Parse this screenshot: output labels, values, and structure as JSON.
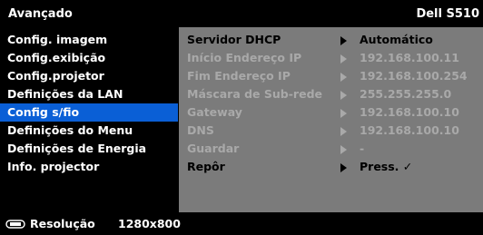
{
  "header": {
    "title": "Avançado",
    "brand": "Dell S510"
  },
  "menu": {
    "items": [
      {
        "label": "Config. imagem"
      },
      {
        "label": "Config.exibição"
      },
      {
        "label": "Config.projetor"
      },
      {
        "label": "Definições da LAN"
      },
      {
        "label": "Config s/fio",
        "selected": true
      },
      {
        "label": "Definições do Menu"
      },
      {
        "label": "Definições de Energia"
      },
      {
        "label": "Info. projector"
      }
    ]
  },
  "settings": {
    "rows": [
      {
        "label": "Servidor DHCP",
        "value": "Automático"
      },
      {
        "label": "Início Endereço IP",
        "value": "192.168.100.11"
      },
      {
        "label": "Fim Endereço IP",
        "value": "192.168.100.254"
      },
      {
        "label": "Máscara de Sub-rede",
        "value": "255.255.255.0"
      },
      {
        "label": "Gateway",
        "value": "192.168.100.10"
      },
      {
        "label": "DNS",
        "value": "192.168.100.10"
      },
      {
        "label": "Guardar",
        "value": "-"
      },
      {
        "label": "Repôr",
        "value": "Press. ✓"
      }
    ]
  },
  "footer": {
    "icon": "input-source-icon",
    "label": "Resolução",
    "value": "1280x800"
  },
  "colors": {
    "selection": "#0a5fd6",
    "panel": "#7b7b7b",
    "background": "#000000"
  }
}
